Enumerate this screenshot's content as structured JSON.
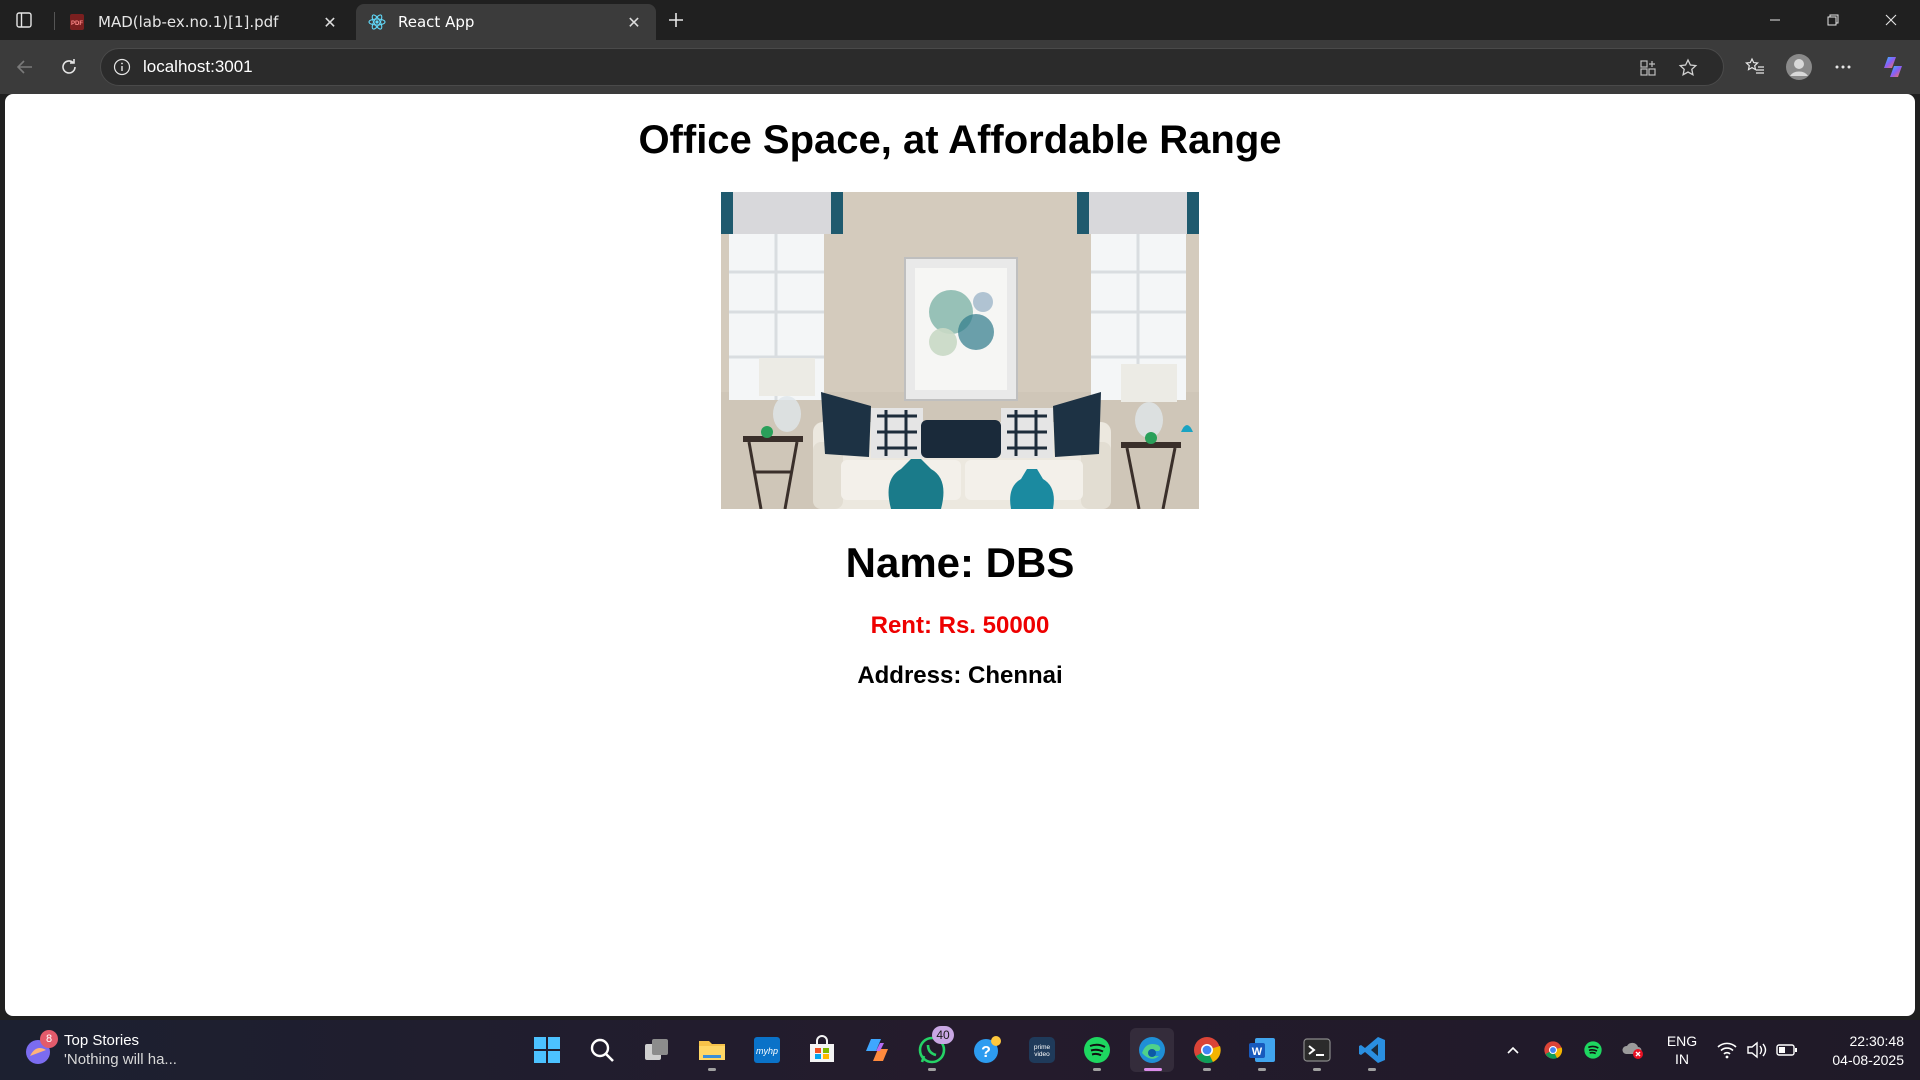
{
  "browser": {
    "tabs": [
      {
        "title": "MAD(lab-ex.no.1)[1].pdf",
        "icon": "pdf-icon",
        "active": false
      },
      {
        "title": "React App",
        "icon": "react-icon",
        "active": true
      }
    ],
    "address": "localhost:3001"
  },
  "page": {
    "heading": "Office Space, at Affordable Range",
    "image_alt": "Living room with white sofa, cushions, lamps and framed painting",
    "name": "Name: DBS",
    "rent": "Rent: Rs. 50000",
    "address": "Address: Chennai"
  },
  "taskbar": {
    "news": {
      "badge": "8",
      "title": "Top Stories",
      "subtitle": "'Nothing will ha..."
    },
    "whatsapp_badge": "40",
    "language": {
      "line1": "ENG",
      "line2": "IN"
    },
    "clock": {
      "time": "22:30:48",
      "date": "04-08-2025"
    }
  },
  "colors": {
    "rent": "#ee0000",
    "tab_bar": "#202020",
    "toolbar": "#3b3b3b"
  }
}
